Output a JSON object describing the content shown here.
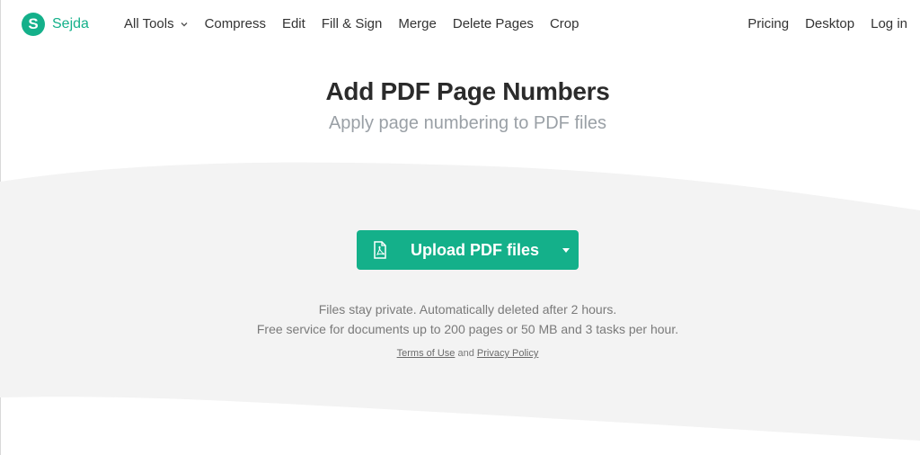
{
  "brand": {
    "name": "Sejda",
    "logo_letter": "S",
    "color": "#14b08a"
  },
  "nav": {
    "left": [
      "All Tools",
      "Compress",
      "Edit",
      "Fill & Sign",
      "Merge",
      "Delete Pages",
      "Crop"
    ],
    "right": [
      "Pricing",
      "Desktop",
      "Log in"
    ]
  },
  "hero": {
    "title": "Add PDF Page Numbers",
    "subtitle": "Apply page numbering to PDF files"
  },
  "upload": {
    "label": "Upload PDF files",
    "icon": "pdf-file-icon",
    "color": "#14b08a"
  },
  "info": {
    "line1": "Files stay private. Automatically deleted after 2 hours.",
    "line2": "Free service for documents up to 200 pages or 50 MB and 3 tasks per hour.",
    "terms": "Terms of Use",
    "and": "and",
    "privacy": "Privacy Policy"
  },
  "colors": {
    "wave_bg": "#f3f3f3",
    "accent": "#14b08a"
  }
}
